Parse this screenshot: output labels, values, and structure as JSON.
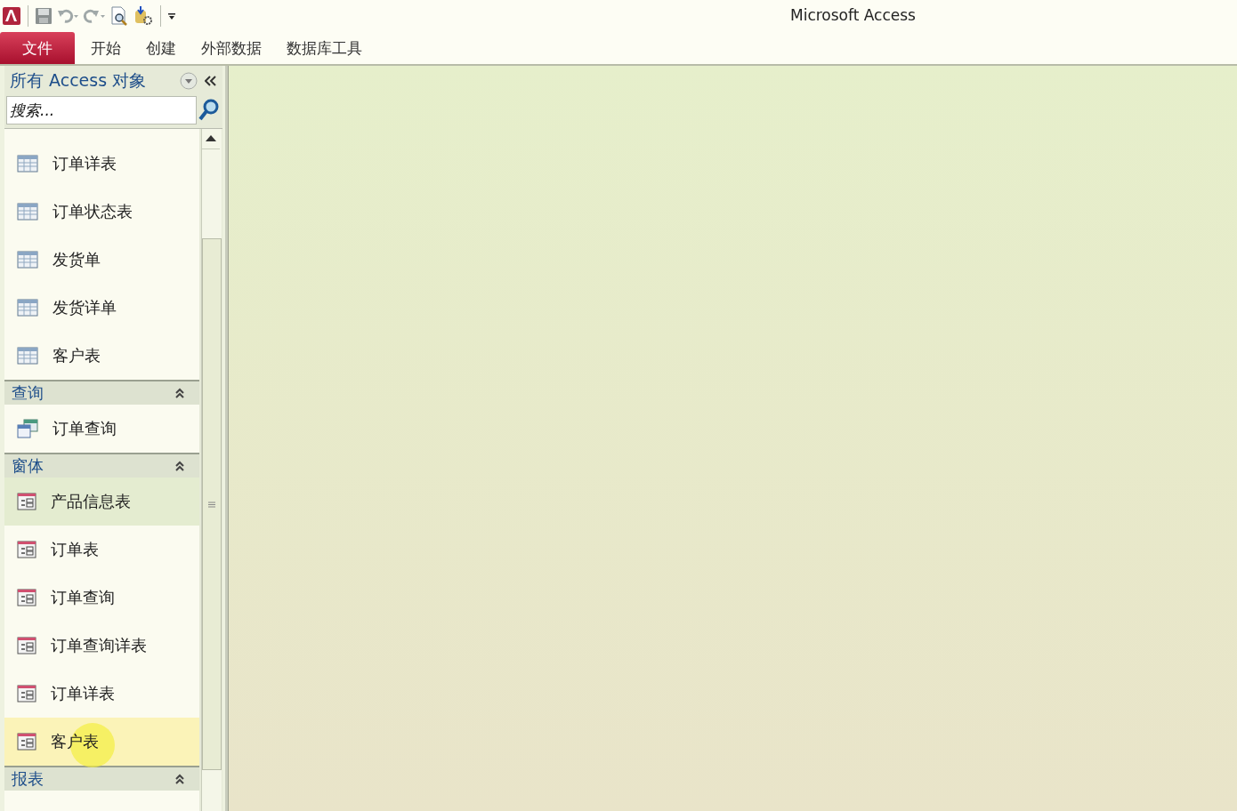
{
  "window": {
    "title": "Microsoft Access"
  },
  "ribbon_tabs": [
    {
      "label": "文件",
      "selected": true
    },
    {
      "label": "开始",
      "selected": false
    },
    {
      "label": "创建",
      "selected": false
    },
    {
      "label": "外部数据",
      "selected": false
    },
    {
      "label": "数据库工具",
      "selected": false
    }
  ],
  "nav_pane": {
    "title": "所有 Access 对象",
    "search": {
      "placeholder": "搜索..."
    },
    "sections": [
      {
        "kind": "table",
        "items": [
          {
            "label": "订单详表",
            "selected": false,
            "hovered": false
          },
          {
            "label": "订单状态表",
            "selected": false,
            "hovered": false
          },
          {
            "label": "发货单",
            "selected": false,
            "hovered": false
          },
          {
            "label": "发货详单",
            "selected": false,
            "hovered": false
          },
          {
            "label": "客户表",
            "selected": false,
            "hovered": false
          }
        ]
      },
      {
        "title": "查询",
        "kind": "query",
        "items": [
          {
            "label": "订单查询",
            "selected": false,
            "hovered": false
          }
        ]
      },
      {
        "title": "窗体",
        "kind": "form",
        "items": [
          {
            "label": "产品信息表",
            "selected": true,
            "hovered": false
          },
          {
            "label": "订单表",
            "selected": false,
            "hovered": false
          },
          {
            "label": "订单查询",
            "selected": false,
            "hovered": false
          },
          {
            "label": "订单查询详表",
            "selected": false,
            "hovered": false
          },
          {
            "label": "订单详表",
            "selected": false,
            "hovered": false
          },
          {
            "label": "客户表",
            "selected": false,
            "hovered": true
          }
        ]
      },
      {
        "title": "报表"
      }
    ]
  }
}
